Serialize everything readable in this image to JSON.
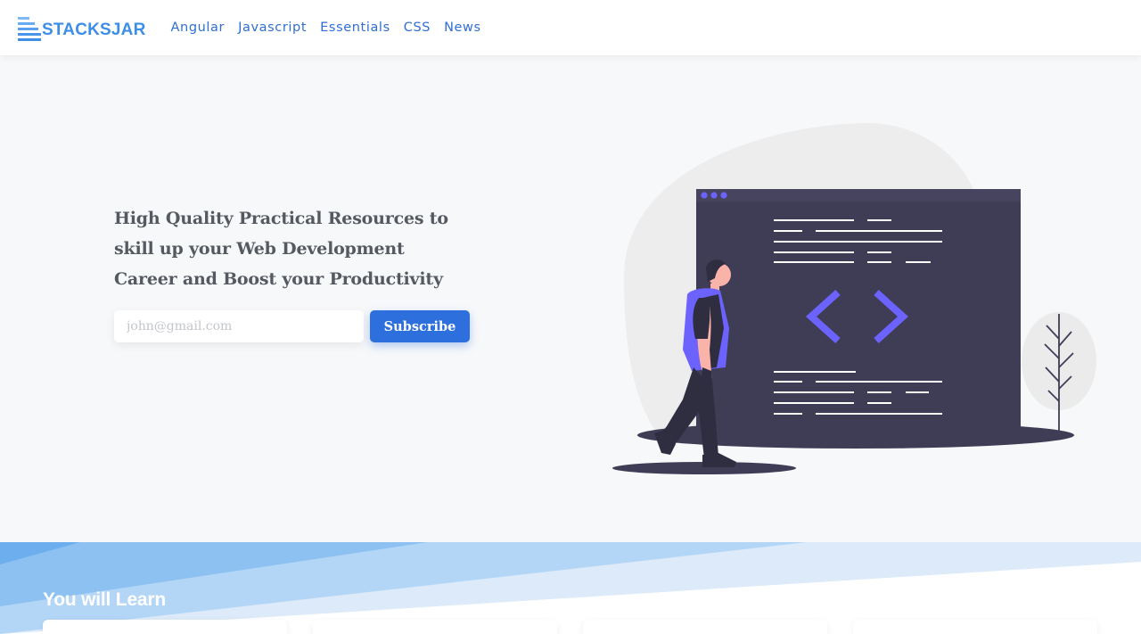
{
  "header": {
    "logo_text": "STACKSJAR",
    "nav": [
      {
        "label": "Angular"
      },
      {
        "label": "Javascript"
      },
      {
        "label": "Essentials"
      },
      {
        "label": "CSS"
      },
      {
        "label": "News"
      }
    ]
  },
  "hero": {
    "title": "High Quality Practical Resources to skill up your Web Development Career and Boost your Productivity",
    "email_placeholder": "john@gmail.com",
    "subscribe_label": "Subscribe"
  },
  "learn": {
    "title": "You will Learn",
    "cards": [
      {},
      {},
      {},
      {}
    ]
  },
  "colors": {
    "brand": "#3d8ee6",
    "nav_link": "#2f6fd1",
    "button": "#2d6fdc",
    "illustration_accent": "#6c63ff",
    "monitor": "#3f3d56",
    "band_light": "#b8d9f7"
  },
  "icons": {
    "logo": "stacked-bars-icon",
    "illustration": "coding-person-illustration"
  }
}
